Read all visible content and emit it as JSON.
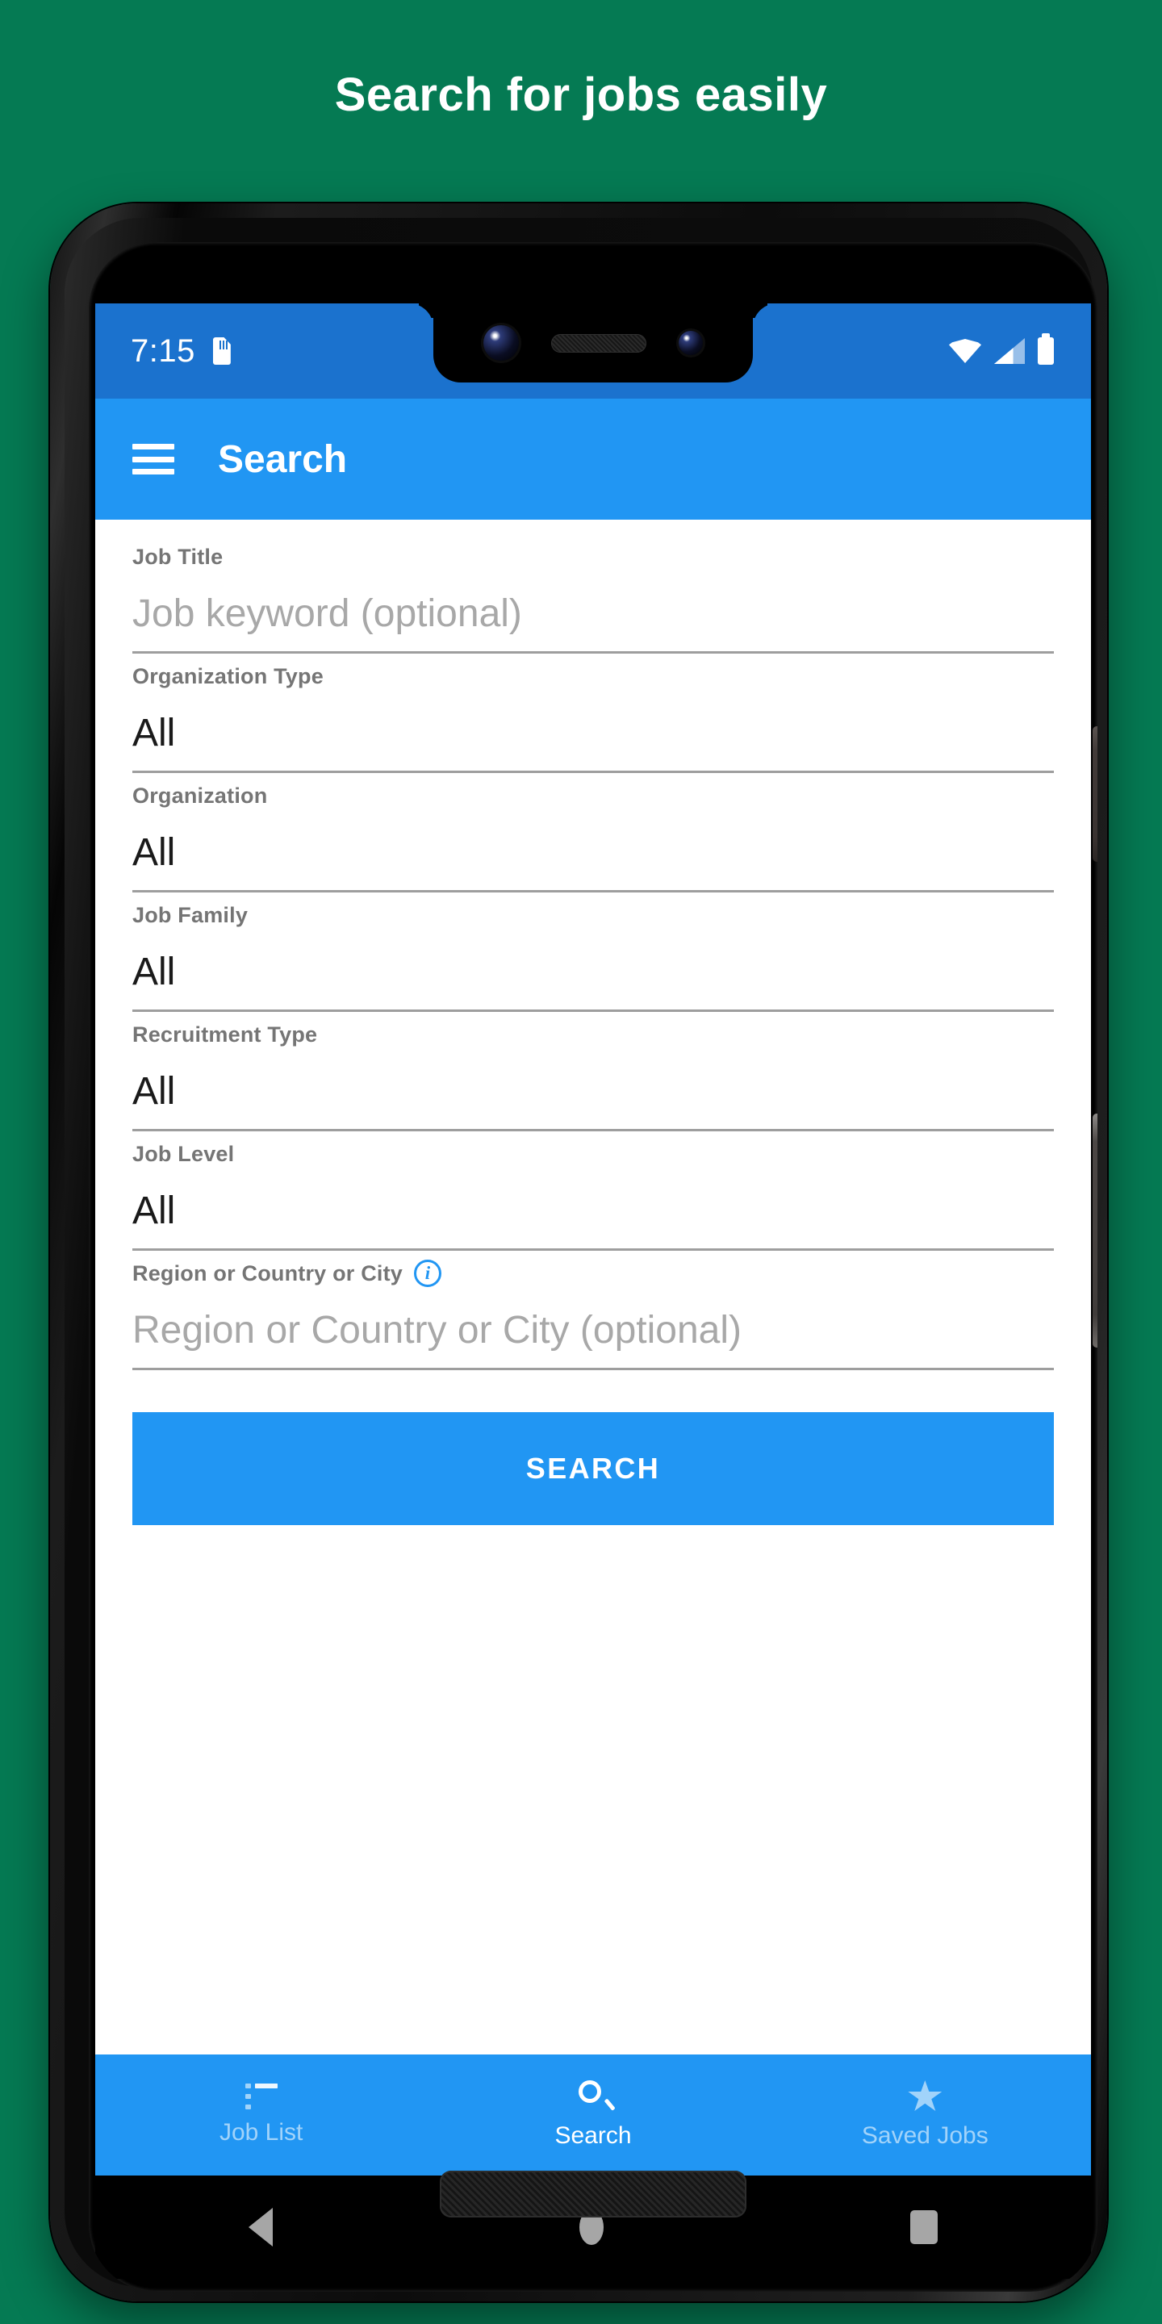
{
  "headline": "Search for jobs easily",
  "colors": {
    "background_green": "#057a53",
    "status_bar_blue": "#1b72ce",
    "app_bar_blue": "#2196f3",
    "accent_blue": "#2196f3",
    "label_gray": "#757575",
    "placeholder_gray": "#a8a8a8"
  },
  "status_bar": {
    "time": "7:15",
    "icons": {
      "sd_card": "sd-card-icon",
      "wifi": "wifi-icon",
      "signal": "cell-signal-icon",
      "battery": "battery-icon"
    }
  },
  "app_bar": {
    "menu_icon": "hamburger-menu-icon",
    "title": "Search"
  },
  "form": {
    "fields": [
      {
        "label": "Job Title",
        "value": "",
        "placeholder": "Job keyword (optional)",
        "type": "text",
        "has_info": false
      },
      {
        "label": "Organization Type",
        "value": "All",
        "placeholder": "",
        "type": "select",
        "has_info": false
      },
      {
        "label": "Organization",
        "value": "All",
        "placeholder": "",
        "type": "select",
        "has_info": false
      },
      {
        "label": "Job Family",
        "value": "All",
        "placeholder": "",
        "type": "select",
        "has_info": false
      },
      {
        "label": "Recruitment Type",
        "value": "All",
        "placeholder": "",
        "type": "select",
        "has_info": false
      },
      {
        "label": "Job Level",
        "value": "All",
        "placeholder": "",
        "type": "select",
        "has_info": false
      },
      {
        "label": "Region or Country or City",
        "value": "",
        "placeholder": "Region or Country or City (optional)",
        "type": "text",
        "has_info": true
      }
    ],
    "info_icon_char": "i",
    "submit_label": "SEARCH"
  },
  "bottom_nav": {
    "items": [
      {
        "label": "Job List",
        "icon": "list-icon",
        "active": false
      },
      {
        "label": "Search",
        "icon": "search-icon",
        "active": true
      },
      {
        "label": "Saved Jobs",
        "icon": "star-icon",
        "active": false
      }
    ]
  },
  "android_nav": {
    "back": "back-triangle-icon",
    "home": "home-circle-icon",
    "recents": "recents-square-icon"
  }
}
